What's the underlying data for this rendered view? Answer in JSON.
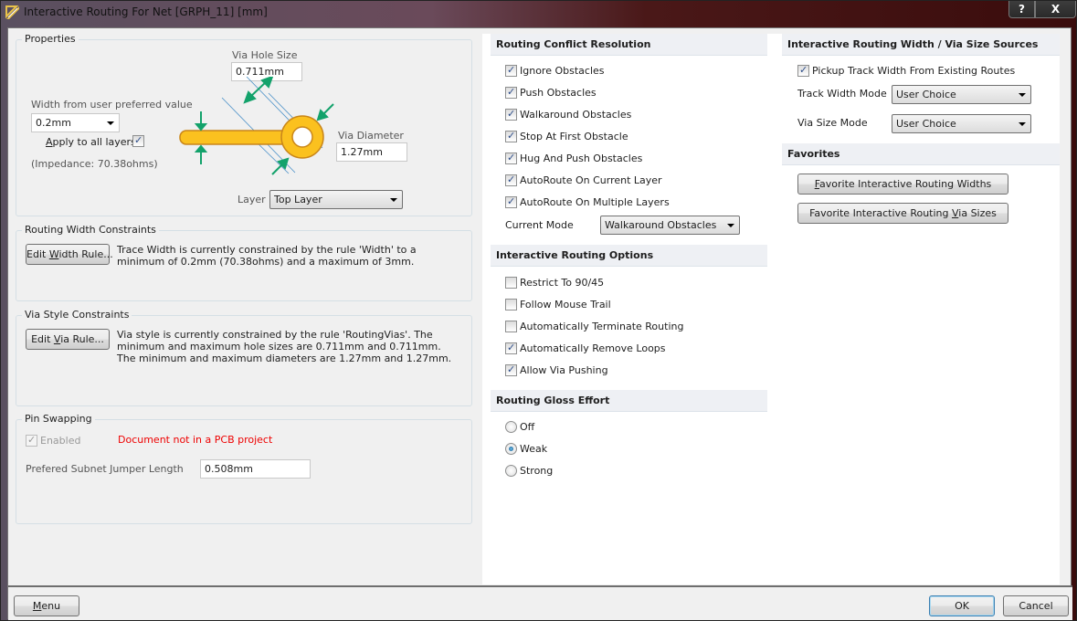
{
  "window": {
    "title": "Interactive Routing For Net [GRPH_11] [mm]",
    "help_label": "?",
    "close_label": "X"
  },
  "properties": {
    "group_title": "Properties",
    "via_hole_size_label": "Via Hole Size",
    "via_hole_size_value": "0.711mm",
    "width_label": "Width from user preferred value",
    "width_value": "0.2mm",
    "apply_all_layers_label": "Apply to all layers",
    "apply_all_layers_checked": true,
    "impedance_text": "(Impedance: 70.38ohms)",
    "via_diameter_label": "Via Diameter",
    "via_diameter_value": "1.27mm",
    "layer_label": "Layer",
    "layer_value": "Top Layer",
    "diagram_colors": {
      "trace": "#fbc11f",
      "trace_outline": "#c9861a",
      "arrow": "#13a26b",
      "guide": "#4a90c8"
    }
  },
  "width_constraints": {
    "group_title": "Routing Width Constraints",
    "button_label": "Edit Width Rule...",
    "description": "Trace Width is currently constrained by the rule 'Width' to a minimum of 0.2mm (70.38ohms) and a maximum of 3mm."
  },
  "via_constraints": {
    "group_title": "Via Style Constraints",
    "button_label": "Edit Via Rule...",
    "description": "Via style is currently constrained by the rule 'RoutingVias'. The minimum and maximum hole sizes are 0.711mm and 0.711mm. The minimum and maximum diameters are 1.27mm and 1.27mm."
  },
  "pin_swapping": {
    "group_title": "Pin Swapping",
    "enabled_label": "Enabled",
    "enabled_checked": true,
    "warning": "Document not in a PCB project",
    "warning_color": "#e00000",
    "jumper_label": "Prefered Subnet Jumper Length",
    "jumper_value": "0.508mm"
  },
  "conflict_resolution": {
    "header": "Routing Conflict Resolution",
    "options": [
      {
        "label": "Ignore Obstacles",
        "checked": true
      },
      {
        "label": "Push Obstacles",
        "checked": true
      },
      {
        "label": "Walkaround Obstacles",
        "checked": true
      },
      {
        "label": "Stop At First Obstacle",
        "checked": true
      },
      {
        "label": "Hug And Push Obstacles",
        "checked": true
      },
      {
        "label": "AutoRoute On Current Layer",
        "checked": true
      },
      {
        "label": "AutoRoute On Multiple Layers",
        "checked": true
      }
    ],
    "current_mode_label": "Current Mode",
    "current_mode_value": "Walkaround Obstacles"
  },
  "routing_options": {
    "header": "Interactive Routing Options",
    "options": [
      {
        "label": "Restrict To 90/45",
        "checked": false
      },
      {
        "label": "Follow Mouse Trail",
        "checked": false
      },
      {
        "label": "Automatically Terminate Routing",
        "checked": false
      },
      {
        "label": "Automatically Remove Loops",
        "checked": true
      },
      {
        "label": "Allow Via Pushing",
        "checked": true
      }
    ]
  },
  "gloss_effort": {
    "header": "Routing Gloss Effort",
    "options": [
      {
        "label": "Off",
        "selected": false
      },
      {
        "label": "Weak",
        "selected": true
      },
      {
        "label": "Strong",
        "selected": false
      }
    ]
  },
  "width_sources": {
    "header": "Interactive Routing Width / Via Size Sources",
    "pickup_label": "Pickup Track Width From Existing Routes",
    "pickup_checked": true,
    "track_width_mode_label": "Track Width Mode",
    "track_width_mode_value": "User Choice",
    "via_size_mode_label": "Via Size Mode",
    "via_size_mode_value": "User Choice"
  },
  "favorites": {
    "header": "Favorites",
    "widths_button": "Favorite Interactive Routing Widths",
    "vias_button": "Favorite Interactive Routing Via Sizes"
  },
  "footer": {
    "menu_label": "Menu",
    "ok_label": "OK",
    "cancel_label": "Cancel"
  }
}
